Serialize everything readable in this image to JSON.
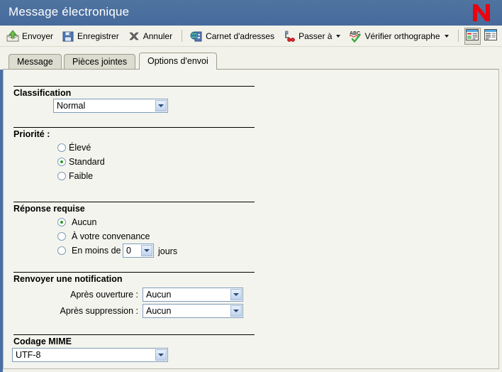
{
  "window": {
    "title": "Message électronique",
    "logo_icon": "novell-n-logo",
    "titlebar_color": "#4a6fa5",
    "content_bg": "#f4f4ee"
  },
  "toolbar": {
    "buttons": [
      {
        "label": "Envoyer",
        "icon": "send-envelope-icon",
        "has_caret": false
      },
      {
        "label": "Enregistrer",
        "icon": "floppy-disk-icon",
        "has_caret": false
      },
      {
        "label": "Annuler",
        "icon": "cancel-x-icon",
        "has_caret": false
      },
      {
        "label": "Carnet d'adresses",
        "icon": "address-book-globe-icon",
        "has_caret": false
      },
      {
        "label": "Passer à",
        "icon": "move-to-icon",
        "has_caret": true
      },
      {
        "label": "Vérifier orthographe",
        "icon": "spell-check-abc-icon",
        "has_caret": true
      }
    ],
    "view_buttons": [
      {
        "icon": "layout-split-view-icon",
        "pressed": true
      },
      {
        "icon": "layout-single-view-icon",
        "pressed": false
      }
    ]
  },
  "tabs": [
    {
      "label": "Message",
      "active": false
    },
    {
      "label": "Pièces jointes",
      "active": false
    },
    {
      "label": "Options d'envoi",
      "active": true
    }
  ],
  "form": {
    "classification": {
      "title": "Classification",
      "select_value": "Normal"
    },
    "priority": {
      "title": "Priorité :",
      "options": [
        {
          "label": "Élevé",
          "selected": false
        },
        {
          "label": "Standard",
          "selected": true
        },
        {
          "label": "Faible",
          "selected": false
        }
      ]
    },
    "reply_requested": {
      "title": "Réponse requise",
      "options": [
        {
          "label": "Aucun",
          "selected": true
        },
        {
          "label": "À votre convenance",
          "selected": false
        },
        {
          "label": "En moins de",
          "selected": false
        }
      ],
      "days_value": "0",
      "days_suffix": "jours"
    },
    "return_notification": {
      "title": "Renvoyer une notification",
      "rows": [
        {
          "label": "Après ouverture :",
          "value": "Aucun"
        },
        {
          "label": "Après suppression :",
          "value": "Aucun"
        }
      ]
    },
    "mime_encoding": {
      "title": "Codage MIME",
      "select_value": "UTF-8"
    }
  }
}
